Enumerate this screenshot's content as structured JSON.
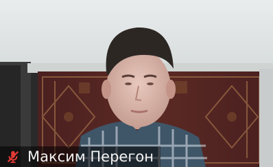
{
  "participant": {
    "name": "Максим Перегон",
    "mic_icon": "microphone-muted-icon",
    "mic_color": "#e53935"
  }
}
